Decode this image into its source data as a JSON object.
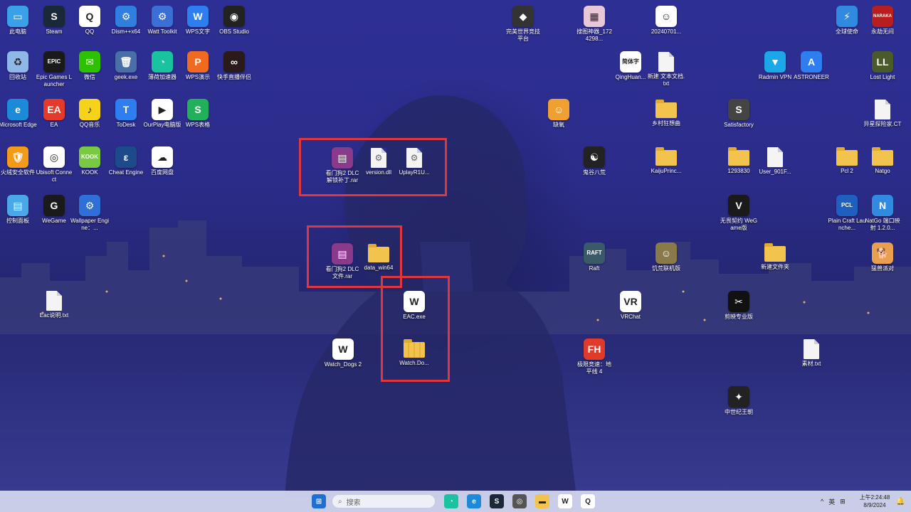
{
  "desktop": {
    "icons": [
      {
        "label": "此电脑",
        "icon": "pc-icon",
        "color": "#3aa0e8",
        "glyph": "▭"
      },
      {
        "label": "Steam",
        "icon": "steam-icon",
        "color": "#1b2838",
        "glyph": "S"
      },
      {
        "label": "QQ",
        "icon": "qq-icon",
        "color": "#ffffff",
        "glyph": "Q"
      },
      {
        "label": "Dism++x64",
        "icon": "dism-gear-icon",
        "color": "#2f7fe0",
        "glyph": "⚙"
      },
      {
        "label": "Watt Toolkit",
        "icon": "watt-gear-icon",
        "color": "#3b6fd6",
        "glyph": "⚙"
      },
      {
        "label": "WPS文字",
        "icon": "wps-writer-icon",
        "color": "#2f7ef0",
        "glyph": "W"
      },
      {
        "label": "OBS Studio",
        "icon": "obs-icon",
        "color": "#222222",
        "glyph": "◉"
      },
      {
        "label": "回收站",
        "icon": "recycle-bin-icon",
        "color": "#8fb8e8",
        "glyph": "♻"
      },
      {
        "label": "Epic Games Launcher",
        "icon": "epic-icon",
        "color": "#1a1a1a",
        "glyph": "EPIC"
      },
      {
        "label": "微信",
        "icon": "wechat-icon",
        "color": "#2dc100",
        "glyph": "✉"
      },
      {
        "label": "geek.exe",
        "icon": "geek-icon",
        "color": "#4a6fa8",
        "glyph": "🗑"
      },
      {
        "label": "薄荷加速器",
        "icon": "mint-accelerator-icon",
        "color": "#19c3a0",
        "glyph": "◔"
      },
      {
        "label": "WPS演示",
        "icon": "wps-presentation-icon",
        "color": "#f06a1f",
        "glyph": "P"
      },
      {
        "label": "快手直播伴侣",
        "icon": "kuaishou-icon",
        "color": "#2b1a1a",
        "glyph": "∞"
      },
      {
        "label": "Microsoft Edge",
        "icon": "edge-icon",
        "color": "#1c8ad8",
        "glyph": "e"
      },
      {
        "label": "EA",
        "icon": "ea-icon",
        "color": "#e53a2a",
        "glyph": "EA"
      },
      {
        "label": "QQ音乐",
        "icon": "qq-music-icon",
        "color": "#f7d21a",
        "glyph": "♪"
      },
      {
        "label": "ToDesk",
        "icon": "todesk-icon",
        "color": "#2f7ef0",
        "glyph": "T"
      },
      {
        "label": "OurPlay电脑版",
        "icon": "ourplay-icon",
        "color": "#ffffff",
        "glyph": "▶"
      },
      {
        "label": "WPS表格",
        "icon": "wps-sheet-icon",
        "color": "#22b05a",
        "glyph": "S"
      },
      {
        "label": "火绒安全软件",
        "icon": "huorong-icon",
        "color": "#f39a1a",
        "glyph": "🛡"
      },
      {
        "label": "Ubisoft Connect",
        "icon": "ubisoft-icon",
        "color": "#ffffff",
        "glyph": "◎"
      },
      {
        "label": "KOOK",
        "icon": "kook-icon",
        "color": "#7ac943",
        "glyph": "KOOK"
      },
      {
        "label": "Cheat Engine",
        "icon": "cheat-engine-icon",
        "color": "#1d4a8a",
        "glyph": "ε"
      },
      {
        "label": "百度网盘",
        "icon": "baidu-pan-icon",
        "color": "#ffffff",
        "glyph": "☁"
      },
      {
        "label": "控制面板",
        "icon": "control-panel-icon",
        "color": "#4aa8e8",
        "glyph": "▤"
      },
      {
        "label": "WeGame",
        "icon": "wegame-icon",
        "color": "#1a1a1a",
        "glyph": "G"
      },
      {
        "label": "Wallpaper Engine：...",
        "icon": "wallpaper-engine-icon",
        "color": "#2f6fd8",
        "glyph": "⚙"
      },
      {
        "label": "Eac说明.txt",
        "icon": "text-file-icon",
        "color": "#f4f4f4",
        "glyph": ""
      },
      {
        "label": "Watch_Dogs 2",
        "icon": "watch-dogs-icon",
        "color": "#ffffff",
        "glyph": "W"
      },
      {
        "label": "看门狗2 DLC 解锁补丁.rar",
        "icon": "winrar-icon",
        "color": "#8a3a8a",
        "glyph": "▤"
      },
      {
        "label": "version.dll",
        "icon": "dll-file-icon",
        "color": "#f4f4f4",
        "glyph": "⚙"
      },
      {
        "label": "UplayR1U...",
        "icon": "dll-file-icon",
        "color": "#f4f4f4",
        "glyph": "⚙"
      },
      {
        "label": "看门狗2 DLC 文件.rar",
        "icon": "winrar-icon",
        "color": "#8a3a8a",
        "glyph": "▤"
      },
      {
        "label": "data_win64",
        "icon": "folder-icon",
        "color": "#f3c44d",
        "glyph": ""
      },
      {
        "label": "EAC.exe",
        "icon": "watch-dogs-icon",
        "color": "#ffffff",
        "glyph": "W"
      },
      {
        "label": "Watch.Do...",
        "icon": "zip-folder-icon",
        "color": "#f3c44d",
        "glyph": ""
      },
      {
        "label": "完美世界竞技平台",
        "icon": "perfect-world-icon",
        "color": "#333333",
        "glyph": "◆"
      },
      {
        "label": "搜图神器_1724298...",
        "icon": "image-search-icon",
        "color": "#e8c8d8",
        "glyph": "▦"
      },
      {
        "label": "20240701...",
        "icon": "image-file-icon",
        "color": "#ffffff",
        "glyph": "☺"
      },
      {
        "label": "全球使命",
        "icon": "global-mission-icon",
        "color": "#2f8ae0",
        "glyph": "⚡"
      },
      {
        "label": "永劫无间",
        "icon": "naraka-icon",
        "color": "#b81e1e",
        "glyph": "NARAKA"
      },
      {
        "label": "QingHuan...",
        "icon": "qinghuan-icon",
        "color": "#ffffff",
        "glyph": "简体字"
      },
      {
        "label": "新建 文本文档.txt",
        "icon": "text-file-icon",
        "color": "#f4f4f4",
        "glyph": ""
      },
      {
        "label": "Radmin VPN",
        "icon": "radmin-vpn-icon",
        "color": "#1aa8e8",
        "glyph": "▼"
      },
      {
        "label": "ASTRONEER",
        "icon": "astroneer-icon",
        "color": "#2f7ef0",
        "glyph": "A"
      },
      {
        "label": "Lost Light",
        "icon": "lost-light-icon",
        "color": "#4a5a2a",
        "glyph": "LL"
      },
      {
        "label": "缺氧",
        "icon": "oxygen-not-included-icon",
        "color": "#f0a030",
        "glyph": "☺"
      },
      {
        "label": "乡村狂想曲",
        "icon": "folder-icon",
        "color": "#f3c44d",
        "glyph": ""
      },
      {
        "label": "Satisfactory",
        "icon": "satisfactory-icon",
        "color": "#444444",
        "glyph": "S"
      },
      {
        "label": "异星探险家.CT",
        "icon": "ct-file-icon",
        "color": "#f4f4f4",
        "glyph": ""
      },
      {
        "label": "鬼谷八荒",
        "icon": "guigu-icon",
        "color": "#222222",
        "glyph": "☯"
      },
      {
        "label": "KaijuPrinc...",
        "icon": "folder-icon",
        "color": "#f3c44d",
        "glyph": ""
      },
      {
        "label": "1293830",
        "icon": "folder-icon",
        "color": "#f3c44d",
        "glyph": ""
      },
      {
        "label": "User_901F...",
        "icon": "file-icon",
        "color": "#f4f4f4",
        "glyph": ""
      },
      {
        "label": "Pcl 2",
        "icon": "folder-icon",
        "color": "#f3c44d",
        "glyph": ""
      },
      {
        "label": "Natgo",
        "icon": "folder-icon",
        "color": "#f3c44d",
        "glyph": ""
      },
      {
        "label": "无畏契约 WeGame版",
        "icon": "valorant-icon",
        "color": "#1a1a1a",
        "glyph": "V"
      },
      {
        "label": "Plain Craft Launche...",
        "icon": "pcl-icon",
        "color": "#1f5fbf",
        "glyph": "PCL"
      },
      {
        "label": "NatGo 端口映射 1.2.0...",
        "icon": "natgo-icon",
        "color": "#2f8ae0",
        "glyph": "N"
      },
      {
        "label": "Raft",
        "icon": "raft-icon",
        "color": "#3a5a6a",
        "glyph": "RAFT"
      },
      {
        "label": "饥荒联机版",
        "icon": "dont-starve-icon",
        "color": "#8a7a4a",
        "glyph": "☺"
      },
      {
        "label": "新建文件夹",
        "icon": "folder-icon",
        "color": "#f3c44d",
        "glyph": ""
      },
      {
        "label": "猛兽派对",
        "icon": "party-animals-icon",
        "color": "#e8a050",
        "glyph": "🐕"
      },
      {
        "label": "VRChat",
        "icon": "vrchat-icon",
        "color": "#ffffff",
        "glyph": "VR"
      },
      {
        "label": "剪映专业版",
        "icon": "capcut-icon",
        "color": "#111111",
        "glyph": "✂"
      },
      {
        "label": "极限竞速：地平线 4",
        "icon": "forza-icon",
        "color": "#e03a2a",
        "glyph": "FH"
      },
      {
        "label": "素材.txt",
        "icon": "text-file-icon",
        "color": "#f4f4f4",
        "glyph": ""
      },
      {
        "label": "中世纪王朝",
        "icon": "medieval-dynasty-icon",
        "color": "#222222",
        "glyph": "✦"
      }
    ]
  },
  "taskbar": {
    "search_placeholder": "搜索",
    "apps": [
      {
        "name": "start-button",
        "color": "#1f6fd0",
        "glyph": "⊞"
      },
      {
        "name": "mint-accelerator-taskbar-icon",
        "color": "#19c3a0",
        "glyph": "◔"
      },
      {
        "name": "edge-taskbar-icon",
        "color": "#1c8ad8",
        "glyph": "e"
      },
      {
        "name": "steam-taskbar-icon",
        "color": "#1b2838",
        "glyph": "S"
      },
      {
        "name": "ubisoft-taskbar-icon",
        "color": "#555555",
        "glyph": "◎"
      },
      {
        "name": "explorer-taskbar-icon",
        "color": "#f3c44d",
        "glyph": "▬"
      },
      {
        "name": "watch-dogs-taskbar-icon",
        "color": "#ffffff",
        "glyph": "W"
      },
      {
        "name": "qq-taskbar-icon",
        "color": "#ffffff",
        "glyph": "Q"
      }
    ],
    "tray": {
      "chevron": "^",
      "ime": "英",
      "ime_mode": "⊞"
    },
    "time": "上午2:24:48",
    "date": "8/9/2024",
    "notification_glyph": "🔔"
  }
}
